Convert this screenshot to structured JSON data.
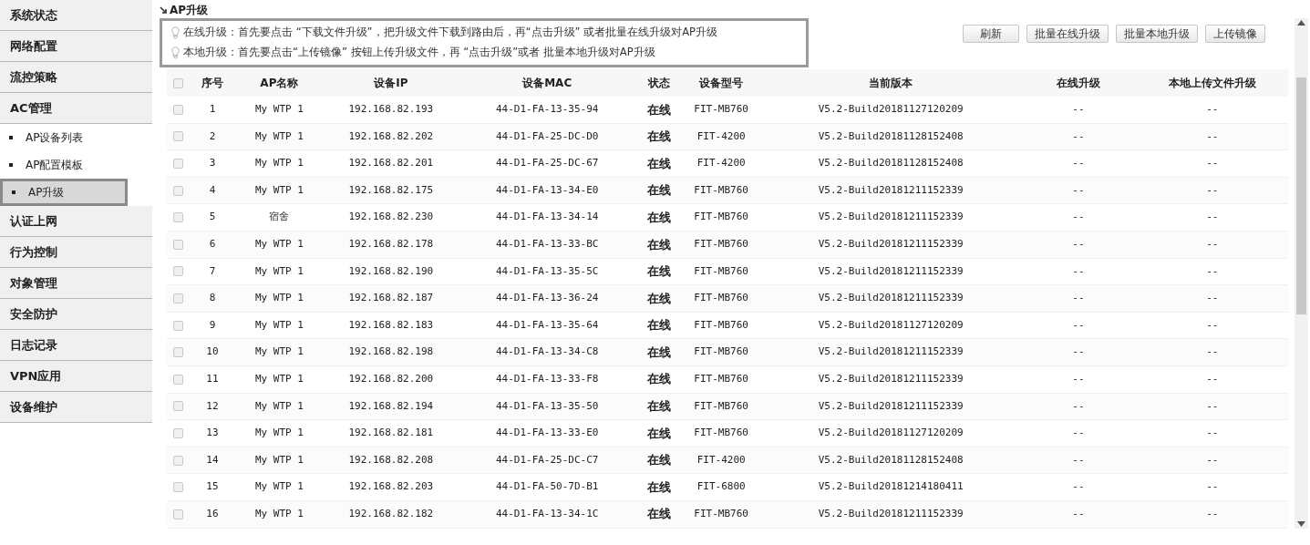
{
  "sidebar": {
    "items": [
      {
        "kind": "group",
        "label": "系统状态",
        "selected": false
      },
      {
        "kind": "group",
        "label": "网络配置",
        "selected": false
      },
      {
        "kind": "group",
        "label": "流控策略",
        "selected": false
      },
      {
        "kind": "group",
        "label": "AC管理",
        "selected": false
      },
      {
        "kind": "subitem",
        "label": "AP设备列表",
        "selected": false
      },
      {
        "kind": "subitem",
        "label": "AP配置模板",
        "selected": false
      },
      {
        "kind": "subitem",
        "label": "AP升级",
        "selected": true
      },
      {
        "kind": "group",
        "label": "认证上网",
        "selected": false
      },
      {
        "kind": "group",
        "label": "行为控制",
        "selected": false
      },
      {
        "kind": "group",
        "label": "对象管理",
        "selected": false
      },
      {
        "kind": "group",
        "label": "安全防护",
        "selected": false
      },
      {
        "kind": "group",
        "label": "日志记录",
        "selected": false
      },
      {
        "kind": "group",
        "label": "VPN应用",
        "selected": false
      },
      {
        "kind": "group",
        "label": "设备维护",
        "selected": false
      }
    ]
  },
  "page_title": "AP升级",
  "notices": [
    "在线升级：首先要点击 “下载文件升级”，把升级文件下载到路由后，再“点击升级” 或者批量在线升级对AP升级",
    "本地升级：首先要点击“上传镜像” 按钮上传升级文件，再 “点击升级”或者 批量本地升级对AP升级"
  ],
  "buttons": [
    "刷新",
    "批量在线升级",
    "批量本地升级",
    "上传镜像"
  ],
  "table": {
    "header_checked": false,
    "columns": [
      "序号",
      "AP名称",
      "设备IP",
      "设备MAC",
      "状态",
      "设备型号",
      "当前版本",
      "在线升级",
      "本地上传文件升级"
    ],
    "rows": [
      {
        "checked": false,
        "cells": [
          "1",
          "My WTP 1",
          "192.168.82.193",
          "44-D1-FA-13-35-94",
          "在线",
          "FIT-MB760",
          "V5.2-Build20181127120209",
          "--",
          "--"
        ]
      },
      {
        "checked": false,
        "cells": [
          "2",
          "My WTP 1",
          "192.168.82.202",
          "44-D1-FA-25-DC-D0",
          "在线",
          "FIT-4200",
          "V5.2-Build20181128152408",
          "--",
          "--"
        ]
      },
      {
        "checked": false,
        "cells": [
          "3",
          "My WTP 1",
          "192.168.82.201",
          "44-D1-FA-25-DC-67",
          "在线",
          "FIT-4200",
          "V5.2-Build20181128152408",
          "--",
          "--"
        ]
      },
      {
        "checked": false,
        "cells": [
          "4",
          "My WTP 1",
          "192.168.82.175",
          "44-D1-FA-13-34-E0",
          "在线",
          "FIT-MB760",
          "V5.2-Build20181211152339",
          "--",
          "--"
        ]
      },
      {
        "checked": false,
        "cells": [
          "5",
          "宿舍",
          "192.168.82.230",
          "44-D1-FA-13-34-14",
          "在线",
          "FIT-MB760",
          "V5.2-Build20181211152339",
          "--",
          "--"
        ]
      },
      {
        "checked": false,
        "cells": [
          "6",
          "My WTP 1",
          "192.168.82.178",
          "44-D1-FA-13-33-BC",
          "在线",
          "FIT-MB760",
          "V5.2-Build20181211152339",
          "--",
          "--"
        ]
      },
      {
        "checked": false,
        "cells": [
          "7",
          "My WTP 1",
          "192.168.82.190",
          "44-D1-FA-13-35-5C",
          "在线",
          "FIT-MB760",
          "V5.2-Build20181211152339",
          "--",
          "--"
        ]
      },
      {
        "checked": false,
        "cells": [
          "8",
          "My WTP 1",
          "192.168.82.187",
          "44-D1-FA-13-36-24",
          "在线",
          "FIT-MB760",
          "V5.2-Build20181211152339",
          "--",
          "--"
        ]
      },
      {
        "checked": false,
        "cells": [
          "9",
          "My WTP 1",
          "192.168.82.183",
          "44-D1-FA-13-35-64",
          "在线",
          "FIT-MB760",
          "V5.2-Build20181127120209",
          "--",
          "--"
        ]
      },
      {
        "checked": false,
        "cells": [
          "10",
          "My WTP 1",
          "192.168.82.198",
          "44-D1-FA-13-34-C8",
          "在线",
          "FIT-MB760",
          "V5.2-Build20181211152339",
          "--",
          "--"
        ]
      },
      {
        "checked": false,
        "cells": [
          "11",
          "My WTP 1",
          "192.168.82.200",
          "44-D1-FA-13-33-F8",
          "在线",
          "FIT-MB760",
          "V5.2-Build20181211152339",
          "--",
          "--"
        ]
      },
      {
        "checked": false,
        "cells": [
          "12",
          "My WTP 1",
          "192.168.82.194",
          "44-D1-FA-13-35-50",
          "在线",
          "FIT-MB760",
          "V5.2-Build20181211152339",
          "--",
          "--"
        ]
      },
      {
        "checked": false,
        "cells": [
          "13",
          "My WTP 1",
          "192.168.82.181",
          "44-D1-FA-13-33-E0",
          "在线",
          "FIT-MB760",
          "V5.2-Build20181127120209",
          "--",
          "--"
        ]
      },
      {
        "checked": false,
        "cells": [
          "14",
          "My WTP 1",
          "192.168.82.208",
          "44-D1-FA-25-DC-C7",
          "在线",
          "FIT-4200",
          "V5.2-Build20181128152408",
          "--",
          "--"
        ]
      },
      {
        "checked": false,
        "cells": [
          "15",
          "My WTP 1",
          "192.168.82.203",
          "44-D1-FA-50-7D-B1",
          "在线",
          "FIT-6800",
          "V5.2-Build20181214180411",
          "--",
          "--"
        ]
      },
      {
        "checked": false,
        "cells": [
          "16",
          "My WTP 1",
          "192.168.82.182",
          "44-D1-FA-13-34-1C",
          "在线",
          "FIT-MB760",
          "V5.2-Build20181211152339",
          "--",
          "--"
        ]
      }
    ]
  }
}
